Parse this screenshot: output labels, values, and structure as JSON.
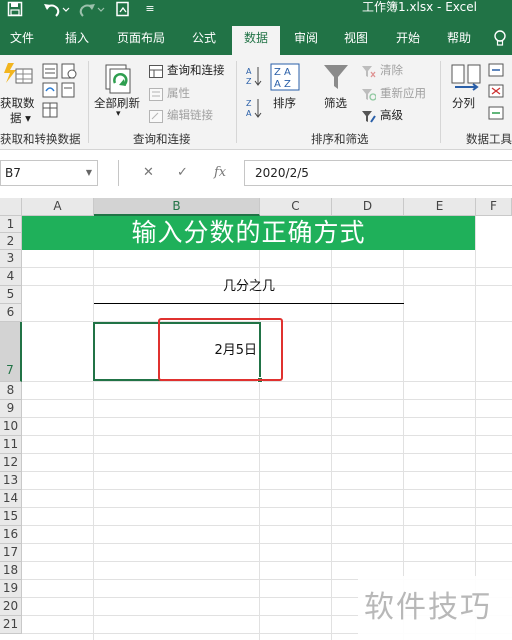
{
  "titlebar": {
    "title": "工作簿1.xlsx  -  Excel",
    "save_icon": "save-icon",
    "undo_icon": "undo-icon",
    "redo_icon": "redo-icon",
    "accent": "#217346"
  },
  "tabs": [
    "文件",
    "插入",
    "页面布局",
    "公式",
    "数据",
    "审阅",
    "视图",
    "开始",
    "帮助"
  ],
  "active_tab": "数据",
  "ribbon": {
    "get_data": {
      "line1": "获取数",
      "line2": "据 ▾",
      "group": "获取和转换数据"
    },
    "refresh_all": {
      "label": "全部刷新",
      "arrow": "▾"
    },
    "queries": {
      "item1": "查询和连接",
      "item2": "属性",
      "item3": "编辑链接",
      "group": "查询和连接"
    },
    "sort": {
      "label": "排序"
    },
    "filter": {
      "label": "筛选",
      "clear": "清除",
      "reapply": "重新应用",
      "advanced": "高级",
      "group": "排序和筛选"
    },
    "split": {
      "label": "分列",
      "group": "数据工具"
    }
  },
  "formula_bar": {
    "name_box": "B7",
    "cancel_symbol": "✕",
    "enter_symbol": "✓",
    "fx_symbol": "fx",
    "value": "2020/2/5"
  },
  "columns": [
    "A",
    "B",
    "C",
    "D",
    "E",
    "F"
  ],
  "rows": [
    "1",
    "2",
    "3",
    "4",
    "5",
    "6",
    "7",
    "8",
    "9",
    "10",
    "11",
    "12",
    "13",
    "14",
    "15",
    "16",
    "17",
    "18",
    "19",
    "20",
    "21"
  ],
  "sheet": {
    "banner": "输入分数的正确方式",
    "subtitle": "几分之几",
    "cell_b7": "2月5日",
    "banner_color": "#1fb05a",
    "highlight_color": "#e0312f"
  },
  "watermark": "软件技巧"
}
